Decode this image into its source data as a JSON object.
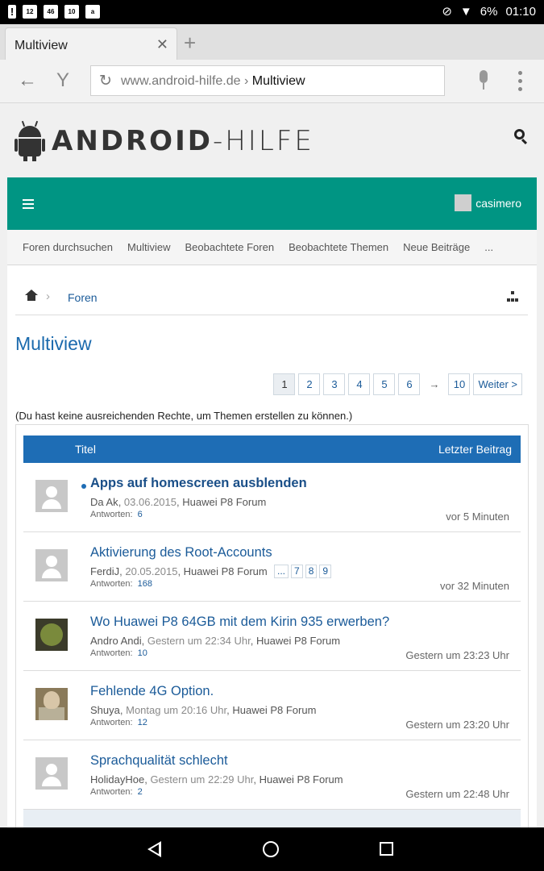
{
  "status_bar": {
    "notif_icons": [
      "!",
      "12",
      "46",
      "10",
      "a"
    ],
    "battery": "6%",
    "time": "01:10"
  },
  "browser": {
    "tab_title": "Multiview",
    "url_domain": "www.android-hilfe.de",
    "url_separator": " › ",
    "url_page": "Multiview"
  },
  "site": {
    "logo_text_a": "ANDROID",
    "logo_text_b": "-HILFE",
    "username": "casimero",
    "subnav": [
      "Foren durchsuchen",
      "Multiview",
      "Beobachtete Foren",
      "Beobachtete Themen",
      "Neue Beiträge",
      "..."
    ]
  },
  "breadcrumb": {
    "sep": "›",
    "link": "Foren"
  },
  "page_title": "Multiview",
  "pagination": {
    "pages": [
      "1",
      "2",
      "3",
      "4",
      "5",
      "6"
    ],
    "current": "1",
    "arrow": "→",
    "last": "10",
    "next": "Weiter >"
  },
  "notice": "(Du hast keine ausreichenden Rechte, um Themen erstellen zu können.)",
  "table": {
    "col_title": "Titel",
    "col_last": "Letzter Beitrag",
    "replies_label": "Antworten:",
    "rows": [
      {
        "title": "Apps auf homescreen ausblenden",
        "author": "Da Ak",
        "date": "03.06.2015",
        "forum": "Huawei P8 Forum",
        "replies": "6",
        "last": "vor 5 Minuten"
      },
      {
        "title": "Aktivierung des Root-Accounts",
        "author": "FerdiJ",
        "date": "20.05.2015",
        "forum": "Huawei P8 Forum",
        "replies": "168",
        "last": "vor 32 Minuten",
        "pages": [
          "...",
          "7",
          "8",
          "9"
        ]
      },
      {
        "title": "Wo Huawei P8 64GB mit dem Kirin 935 erwerben?",
        "author": "Andro Andi",
        "date": "Gestern um 22:34 Uhr",
        "forum": "Huawei P8 Forum",
        "replies": "10",
        "last": "Gestern um 23:23 Uhr"
      },
      {
        "title": "Fehlende 4G Option.",
        "author": "Shuya",
        "date": "Montag um 20:16 Uhr",
        "forum": "Huawei P8 Forum",
        "replies": "12",
        "last": "Gestern um 23:20 Uhr"
      },
      {
        "title": "Sprachqualität schlecht",
        "author": "HolidayHoe",
        "date": "Gestern um 22:29 Uhr",
        "forum": "Huawei P8 Forum",
        "replies": "2",
        "last": "Gestern um 22:48 Uhr"
      }
    ]
  }
}
